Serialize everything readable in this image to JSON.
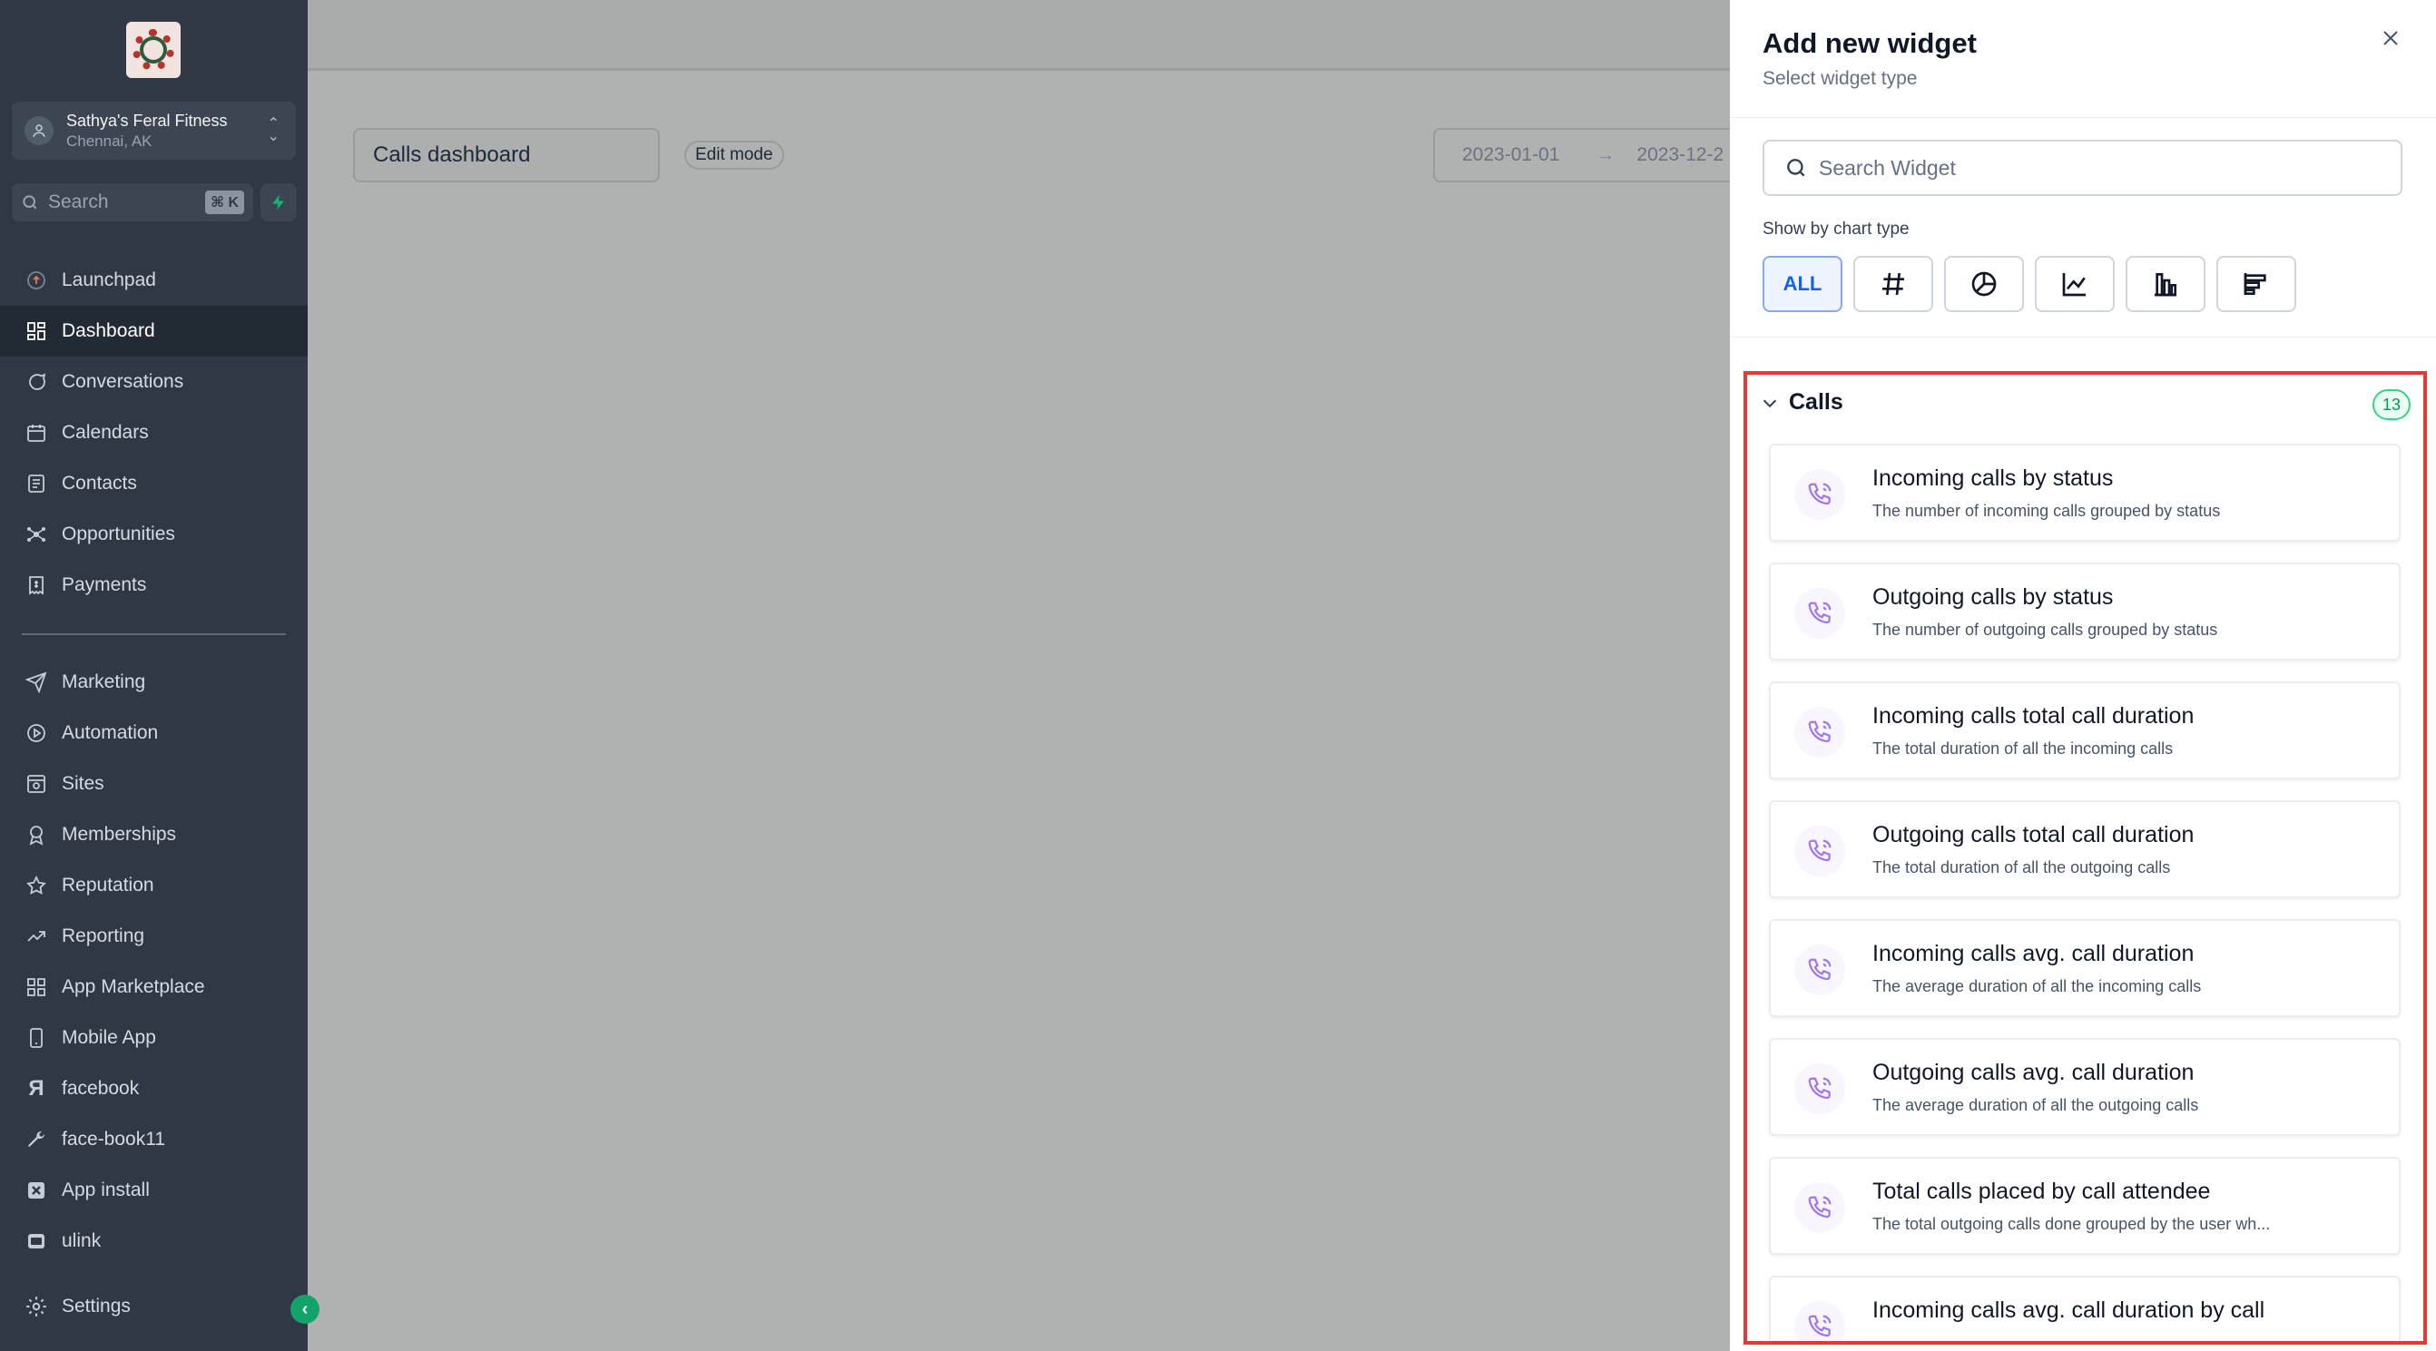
{
  "sidebar": {
    "account": {
      "name": "Sathya's Feral Fitness",
      "location": "Chennai, AK"
    },
    "search": {
      "placeholder": "Search",
      "shortcut": "⌘ K"
    },
    "items": [
      {
        "label": "Launchpad",
        "icon": "rocket-icon"
      },
      {
        "label": "Dashboard",
        "icon": "grid-icon",
        "active": true
      },
      {
        "label": "Conversations",
        "icon": "chat-bubble-icon"
      },
      {
        "label": "Calendars",
        "icon": "calendar-icon"
      },
      {
        "label": "Contacts",
        "icon": "contact-card-icon"
      },
      {
        "label": "Opportunities",
        "icon": "network-icon"
      },
      {
        "label": "Payments",
        "icon": "receipt-icon"
      },
      {
        "label": "Marketing",
        "icon": "send-icon"
      },
      {
        "label": "Automation",
        "icon": "play-circle-icon"
      },
      {
        "label": "Sites",
        "icon": "browser-icon"
      },
      {
        "label": "Memberships",
        "icon": "badge-icon"
      },
      {
        "label": "Reputation",
        "icon": "star-icon"
      },
      {
        "label": "Reporting",
        "icon": "trend-icon"
      },
      {
        "label": "App Marketplace",
        "icon": "apps-icon"
      },
      {
        "label": "Mobile App",
        "icon": "phone-icon"
      },
      {
        "label": "facebook",
        "icon": "custom-icon"
      },
      {
        "label": "face-book11",
        "icon": "wrench-icon"
      },
      {
        "label": "App install",
        "icon": "x-square-icon"
      },
      {
        "label": "ulink",
        "icon": "play-square-icon"
      }
    ],
    "settings_label": "Settings"
  },
  "main": {
    "dashboard_name": "Calls dashboard",
    "edit_mode": "Edit mode",
    "date_start": "2023-01-01",
    "date_end": "2023-12-2"
  },
  "panel": {
    "title": "Add new widget",
    "subtitle": "Select widget type",
    "search_placeholder": "Search Widget",
    "chart_type_label": "Show by chart type",
    "filters": [
      {
        "label": "ALL",
        "active": true
      },
      {
        "icon": "hash-icon"
      },
      {
        "icon": "pie-chart-icon"
      },
      {
        "icon": "line-chart-icon"
      },
      {
        "icon": "bar-chart-icon"
      },
      {
        "icon": "horizontal-bar-chart-icon"
      }
    ],
    "section": {
      "title": "Calls",
      "count": "13",
      "widgets": [
        {
          "title": "Incoming calls by status",
          "description": "The number of incoming calls grouped by status"
        },
        {
          "title": "Outgoing calls by status",
          "description": "The number of outgoing calls grouped by status"
        },
        {
          "title": "Incoming calls total call duration",
          "description": "The total duration of all the incoming calls"
        },
        {
          "title": "Outgoing calls total call duration",
          "description": "The total duration of all the outgoing calls"
        },
        {
          "title": "Incoming calls avg. call duration",
          "description": "The average duration of all the incoming calls"
        },
        {
          "title": "Outgoing calls avg. call duration",
          "description": "The average duration of all the outgoing calls"
        },
        {
          "title": "Total calls placed by call attendee",
          "description": "The total outgoing calls done grouped by the user wh..."
        },
        {
          "title": "Incoming calls avg. call duration by call",
          "description": ""
        }
      ]
    }
  },
  "colors": {
    "sidebar_bg": "#2f3844",
    "accent_blue": "#155eef",
    "highlight_red": "#e53935",
    "count_green": "#039855",
    "icon_purple": "#9e77ed"
  }
}
